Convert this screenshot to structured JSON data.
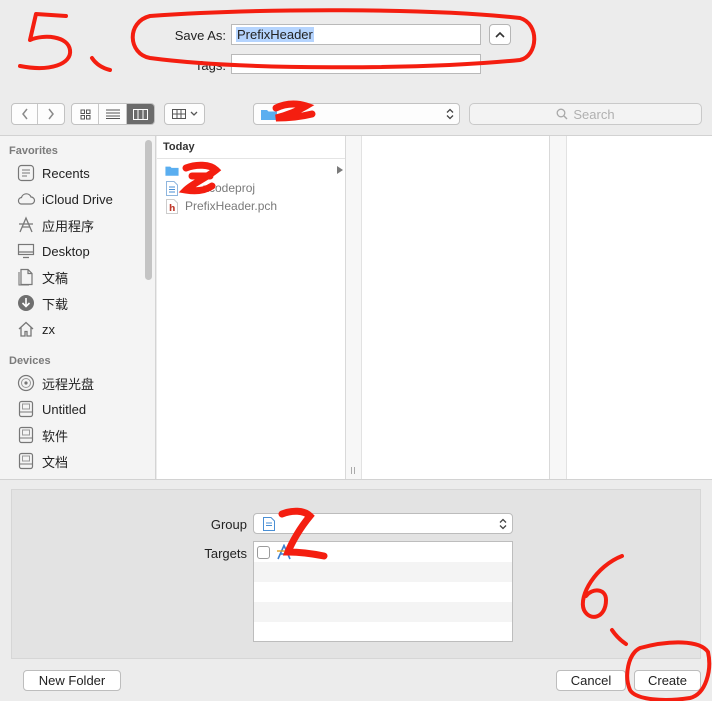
{
  "save_as": {
    "label": "Save As:",
    "value": "PrefixHeader"
  },
  "tags": {
    "label": "Tags:",
    "value": ""
  },
  "toolbar": {
    "back_icon": "chevron-left-icon",
    "forward_icon": "chevron-right-icon",
    "view_modes": [
      "icon-view",
      "list-view",
      "column-view"
    ],
    "active_view": "column-view",
    "search_placeholder": "Search"
  },
  "sidebar": {
    "sections": [
      {
        "title": "Favorites",
        "items": [
          {
            "label": "Recents",
            "icon": "clock-icon"
          },
          {
            "label": "iCloud Drive",
            "icon": "cloud-icon"
          },
          {
            "label": "应用程序",
            "icon": "applications-icon"
          },
          {
            "label": "Desktop",
            "icon": "desktop-icon"
          },
          {
            "label": "文稿",
            "icon": "documents-icon"
          },
          {
            "label": "下载",
            "icon": "download-icon"
          },
          {
            "label": "zx",
            "icon": "home-icon"
          }
        ]
      },
      {
        "title": "Devices",
        "items": [
          {
            "label": "远程光盘",
            "icon": "disc-icon"
          },
          {
            "label": "Untitled",
            "icon": "drive-icon"
          },
          {
            "label": "软件",
            "icon": "drive-icon"
          },
          {
            "label": "文档",
            "icon": "drive-icon"
          }
        ]
      }
    ]
  },
  "browser": {
    "section_title": "Today",
    "files": [
      {
        "label": "",
        "icon": "folder-icon"
      },
      {
        "label": "xcodeproj",
        "icon": "xcodeproj-icon"
      },
      {
        "label": "PrefixHeader.pch",
        "icon": "header-file-icon"
      }
    ]
  },
  "options": {
    "group_label": "Group",
    "targets_label": "Targets"
  },
  "buttons": {
    "new_folder": "New Folder",
    "cancel": "Cancel",
    "create": "Create"
  },
  "annotations": {
    "step_5": "5、",
    "step_6": "6、"
  },
  "colors": {
    "annotation_red": "#f41e10",
    "folder_blue": "#5aaef0",
    "selection": "#b5d4fe"
  }
}
